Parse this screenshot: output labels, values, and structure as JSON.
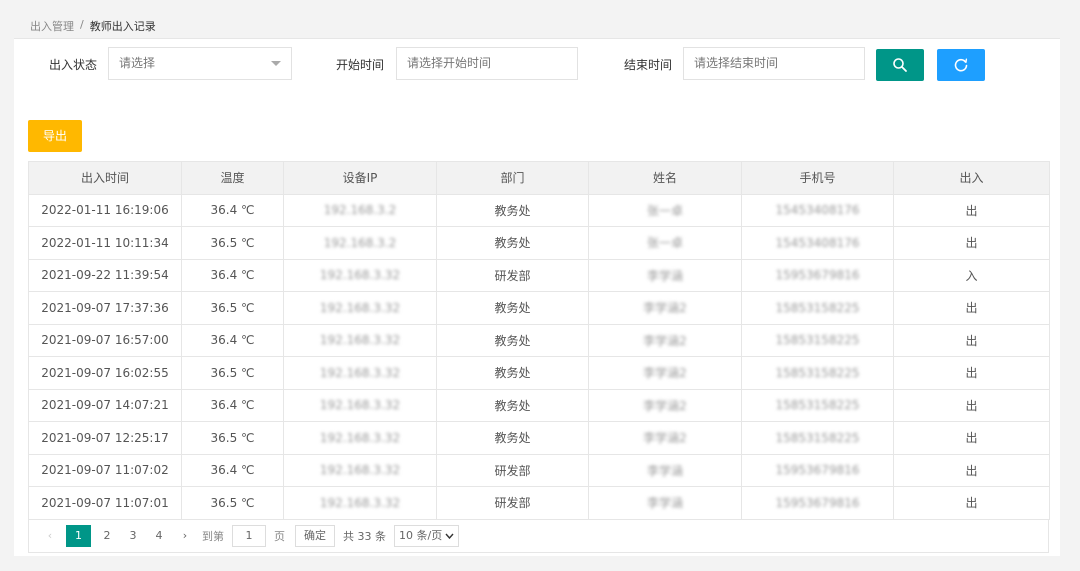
{
  "breadcrumb": {
    "parent": "出入管理",
    "sep": "/",
    "current": "教师出入记录"
  },
  "filters": {
    "status_label": "出入状态",
    "status_value": "请选择",
    "start_label": "开始时间",
    "start_placeholder": "请选择开始时间",
    "end_label": "结束时间",
    "end_placeholder": "请选择结束时间"
  },
  "toolbar": {
    "export_label": "导出"
  },
  "colors": {
    "search": "#009688",
    "refresh": "#1e9fff",
    "export": "#ffb800"
  },
  "icons": {
    "search": "search-icon",
    "refresh": "refresh-icon",
    "caret": "chevron-down-icon"
  },
  "table": {
    "headers": [
      "出入时间",
      "温度",
      "设备IP",
      "部门",
      "姓名",
      "手机号",
      "出入"
    ],
    "rows": [
      [
        "2022-01-11 16:19:06",
        "36.4 ℃",
        "192.168.3.2",
        "教务处",
        "张一卓",
        "15453408176",
        "出"
      ],
      [
        "2022-01-11 10:11:34",
        "36.5 ℃",
        "192.168.3.2",
        "教务处",
        "张一卓",
        "15453408176",
        "出"
      ],
      [
        "2021-09-22 11:39:54",
        "36.4 ℃",
        "192.168.3.32",
        "研发部",
        "李学涵",
        "15953679816",
        "入"
      ],
      [
        "2021-09-07 17:37:36",
        "36.5 ℃",
        "192.168.3.32",
        "教务处",
        "李学涵2",
        "15853158225",
        "出"
      ],
      [
        "2021-09-07 16:57:00",
        "36.4 ℃",
        "192.168.3.32",
        "教务处",
        "李学涵2",
        "15853158225",
        "出"
      ],
      [
        "2021-09-07 16:02:55",
        "36.5 ℃",
        "192.168.3.32",
        "教务处",
        "李学涵2",
        "15853158225",
        "出"
      ],
      [
        "2021-09-07 14:07:21",
        "36.4 ℃",
        "192.168.3.32",
        "教务处",
        "李学涵2",
        "15853158225",
        "出"
      ],
      [
        "2021-09-07 12:25:17",
        "36.5 ℃",
        "192.168.3.32",
        "教务处",
        "李学涵2",
        "15853158225",
        "出"
      ],
      [
        "2021-09-07 11:07:02",
        "36.4 ℃",
        "192.168.3.32",
        "研发部",
        "李学涵",
        "15953679816",
        "出"
      ],
      [
        "2021-09-07 11:07:01",
        "36.5 ℃",
        "192.168.3.32",
        "研发部",
        "李学涵",
        "15953679816",
        "出"
      ]
    ]
  },
  "pager": {
    "prev": "‹",
    "pages": [
      "1",
      "2",
      "3",
      "4"
    ],
    "next": "›",
    "goto_label": "到第",
    "goto_value": "1",
    "page_unit": "页",
    "ok_label": "确定",
    "total_text": "共 33 条",
    "size_value": "10 条/页"
  }
}
